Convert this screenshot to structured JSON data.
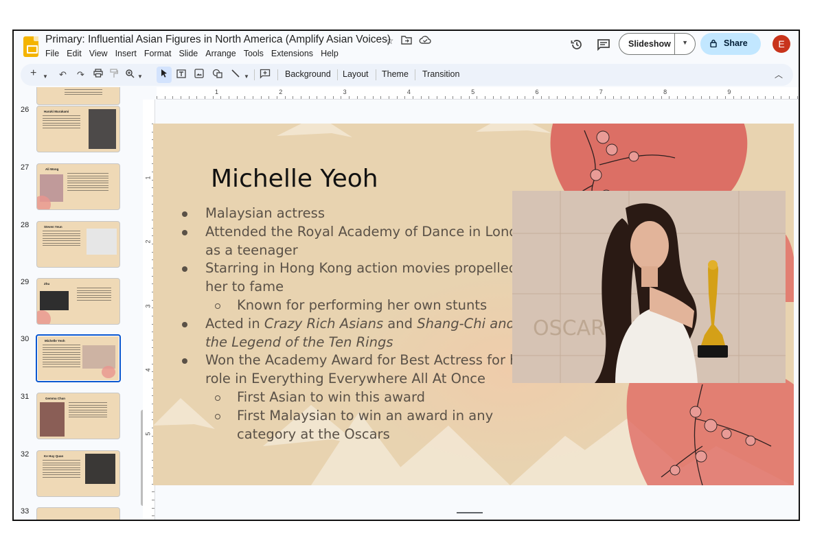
{
  "app": {
    "title": "Primary: Influential Asian Figures in North America (Amplify Asian Voices)",
    "menu": [
      "File",
      "Edit",
      "View",
      "Insert",
      "Format",
      "Slide",
      "Arrange",
      "Tools",
      "Extensions",
      "Help"
    ],
    "slideshow_label": "Slideshow",
    "share_label": "Share",
    "avatar_initial": "E"
  },
  "toolbar": {
    "background_label": "Background",
    "layout_label": "Layout",
    "theme_label": "Theme",
    "transition_label": "Transition"
  },
  "filmstrip": [
    {
      "num": "26",
      "title": "Haruki Murakami",
      "selected": false
    },
    {
      "num": "27",
      "title": "Ali Wong",
      "selected": false
    },
    {
      "num": "28",
      "title": "Steven Yeun",
      "selected": false
    },
    {
      "num": "29",
      "title": "Zhu",
      "selected": false
    },
    {
      "num": "30",
      "title": "Michelle Yeoh",
      "selected": true
    },
    {
      "num": "31",
      "title": "Gemma Chan",
      "selected": false
    },
    {
      "num": "32",
      "title": "Ke Huy Quan",
      "selected": false
    },
    {
      "num": "33",
      "title": "",
      "selected": false
    }
  ],
  "ruler": {
    "h_labels": [
      "1",
      "2",
      "3",
      "4",
      "5",
      "6",
      "7",
      "8",
      "9"
    ],
    "v_labels": [
      "1",
      "2",
      "3",
      "4",
      "5"
    ]
  },
  "slide": {
    "title": "Michelle Yeoh",
    "b1": "Malaysian actress",
    "b2": "Attended the Royal Academy of Dance in London as a teenager",
    "b3": "Starring in Hong Kong action movies propelled her to fame",
    "b3_sub1": "Known for performing her own stunts",
    "b4_pre": "Acted in ",
    "b4_it1": "Crazy Rich Asians",
    "b4_mid": " and ",
    "b4_it2": "Shang-Chi and the Legend of the Ten Rings",
    "b5": "Won the Academy Award for Best Actress for her role in Everything Everywhere All At Once",
    "b5_sub1": "First Asian to win this award",
    "b5_sub2": "First Malaysian to win an award in any category at the Oscars",
    "photo_backdrop_text": "OSCARS95"
  },
  "colors": {
    "slide_bg": "#e8d3b0",
    "accent_red": "#d9534f",
    "selection_blue": "#0b57d0",
    "share_bg": "#c2e7ff"
  }
}
